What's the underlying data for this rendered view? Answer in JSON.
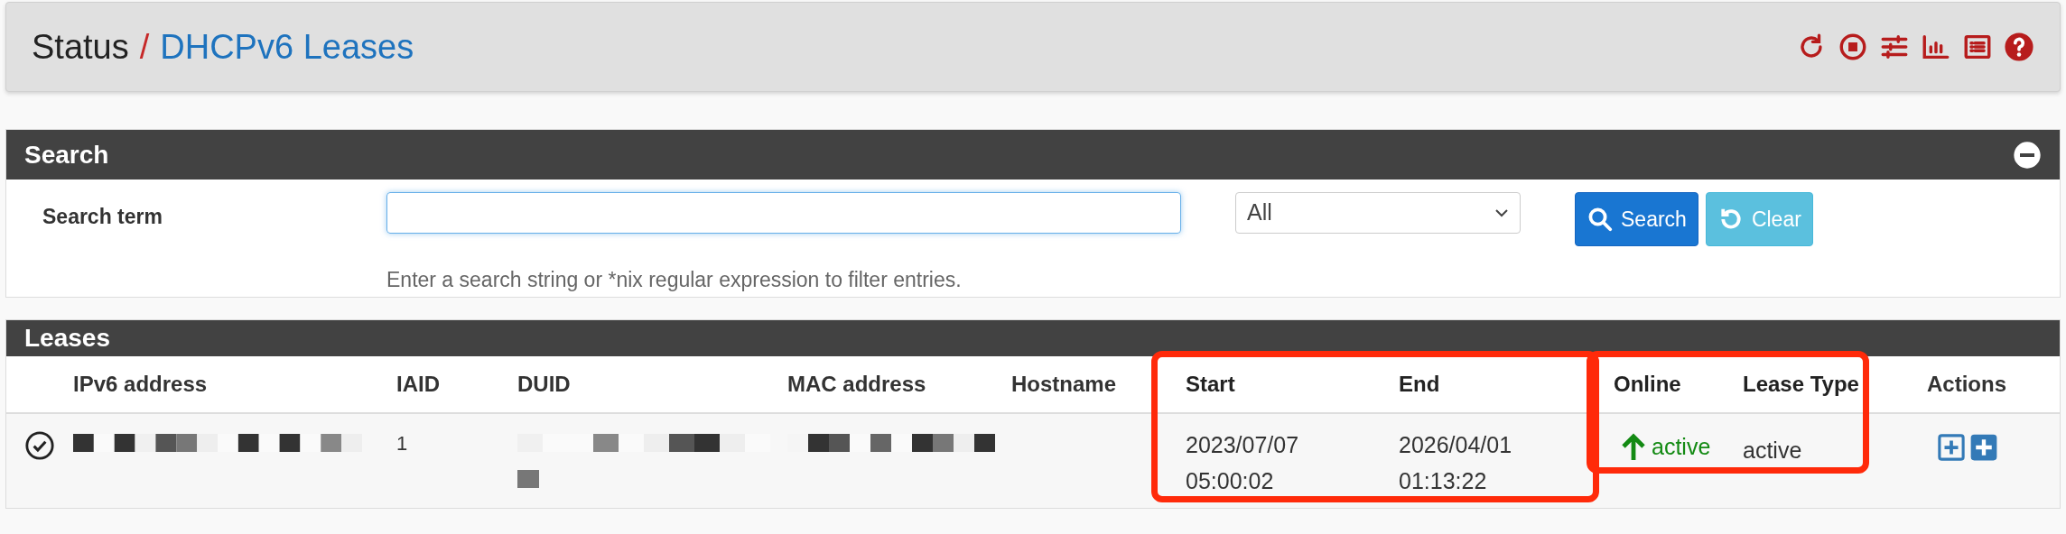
{
  "header": {
    "breadcrumb": [
      {
        "text": "Status",
        "link": false
      },
      {
        "text": "DHCPv6 Leases",
        "link": true
      }
    ],
    "separator": "/"
  },
  "search_panel": {
    "title": "Search",
    "expanded": true,
    "label": "Search term",
    "filter_select": "All",
    "buttons": [
      {
        "kind": "search",
        "label": "Search"
      },
      {
        "kind": "clear",
        "label": "Clear"
      }
    ],
    "help": "Enter a search string or *nix regular expression to filter entries."
  },
  "leases_panel": {
    "title": "Leases",
    "columns": [
      {
        "label": "IPv6 address",
        "highlighted": false
      },
      {
        "label": "IAID",
        "highlighted": false
      },
      {
        "label": "DUID",
        "highlighted": false
      },
      {
        "label": "MAC address",
        "highlighted": false
      },
      {
        "label": "Hostname",
        "highlighted": false
      },
      {
        "label": "Start",
        "highlighted": true
      },
      {
        "label": "End",
        "highlighted": true
      },
      {
        "label": "Online",
        "highlighted": true
      },
      {
        "label": "Lease Type",
        "highlighted": true
      },
      {
        "label": "Actions",
        "highlighted": false
      }
    ],
    "rows": [
      {
        "iaid": "1",
        "start": "2023/07/07 05:00:02",
        "end": "2026/04/01 01:13:22",
        "online": true,
        "online_text": "active",
        "lease_type": "active"
      }
    ]
  }
}
